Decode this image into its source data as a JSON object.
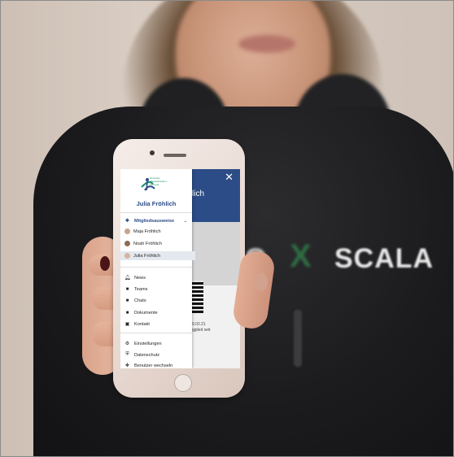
{
  "background_logo": {
    "letter": "O",
    "mark": "X",
    "word": "SCALA"
  },
  "app": {
    "title_fragment": "lich",
    "card_date": "9.02.21",
    "card_since": "gglied seit"
  },
  "drawer": {
    "brand_text": "Deutsche Alkoholkranken-Verband",
    "user_name": "Julia Fröhlich",
    "sections": {
      "membership_label": "Mitgliedsausweise",
      "members": [
        {
          "label": "Maja Fröhlich",
          "avatar_color": "#c9a38a"
        },
        {
          "label": "Noah Fröhlich",
          "avatar_color": "#8e6b54"
        },
        {
          "label": "Julia Fröhlich",
          "avatar_color": "#d6b39d"
        }
      ]
    },
    "menu": [
      {
        "label": "News",
        "icon": "bell-icon"
      },
      {
        "label": "Teams",
        "icon": "users-icon"
      },
      {
        "label": "Chats",
        "icon": "chat-icon"
      },
      {
        "label": "Dokumente",
        "icon": "document-icon"
      },
      {
        "label": "Kontakt",
        "icon": "contact-icon"
      }
    ],
    "settings": [
      {
        "label": "Einstellungen",
        "icon": "gear-icon"
      },
      {
        "label": "Datenschutz",
        "icon": "shield-icon"
      },
      {
        "label": "Benutzer wechseln",
        "icon": "switch-user-icon"
      }
    ]
  },
  "colors": {
    "primary": "#2b4c86",
    "hoodie": "#1b1b1d",
    "nail": "#4b1416"
  }
}
